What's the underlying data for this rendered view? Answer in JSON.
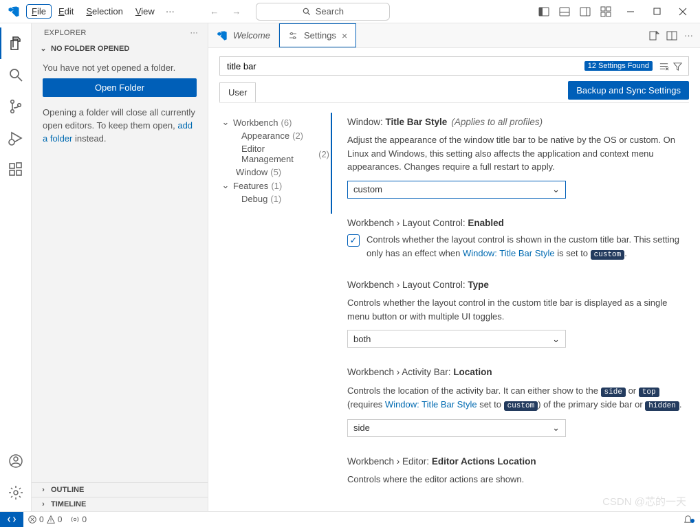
{
  "menu": {
    "file": "File",
    "edit": "Edit",
    "selection": "Selection",
    "view": "View"
  },
  "search_placeholder": "Search",
  "sidebar": {
    "title": "EXPLORER",
    "section": "NO FOLDER OPENED",
    "no_folder": "You have not yet opened a folder.",
    "open_btn": "Open Folder",
    "desc_pre": "Opening a folder will close all currently open editors. To keep them open, ",
    "desc_link": "add a folder",
    "desc_post": " instead.",
    "outline": "OUTLINE",
    "timeline": "TIMELINE"
  },
  "tabs": {
    "welcome": "Welcome",
    "settings": "Settings"
  },
  "search_value": "title bar",
  "found_badge": "12 Settings Found",
  "scope_user": "User",
  "backup_btn": "Backup and Sync Settings",
  "toc": {
    "workbench": "Workbench",
    "workbench_c": "(6)",
    "appearance": "Appearance",
    "appearance_c": "(2)",
    "editor_mgmt": "Editor Management",
    "editor_mgmt_c": "(2)",
    "window": "Window",
    "window_c": "(5)",
    "features": "Features",
    "features_c": "(1)",
    "debug": "Debug",
    "debug_c": "(1)"
  },
  "s1": {
    "scope": "Window: ",
    "name": "Title Bar Style",
    "hint": "(Applies to all profiles)",
    "desc": "Adjust the appearance of the window title bar to be native by the OS or custom. On Linux and Windows, this setting also affects the application and context menu appearances. Changes require a full restart to apply.",
    "value": "custom"
  },
  "s2": {
    "scope": "Workbench › Layout Control: ",
    "name": "Enabled",
    "desc_a": "Controls whether the layout control is shown in the custom title bar. This setting only has an effect when ",
    "link": "Window: Title Bar Style",
    "desc_b": " is set to ",
    "pill": "custom",
    "desc_c": "."
  },
  "s3": {
    "scope": "Workbench › Layout Control: ",
    "name": "Type",
    "desc": "Controls whether the layout control in the custom title bar is displayed as a single menu button or with multiple UI toggles.",
    "value": "both"
  },
  "s4": {
    "scope": "Workbench › Activity Bar: ",
    "name": "Location",
    "desc_a": "Controls the location of the activity bar. It can either show to the ",
    "p1": "side",
    "desc_b": " or ",
    "p2": "top",
    "desc_c": " (requires ",
    "link": "Window: Title Bar Style",
    "desc_d": " set to ",
    "p3": "custom",
    "desc_e": ") of the primary side bar or ",
    "p4": "hidden",
    "desc_f": ".",
    "value": "side"
  },
  "s5": {
    "scope": "Workbench › Editor: ",
    "name": "Editor Actions Location",
    "desc": "Controls where the editor actions are shown."
  },
  "status": {
    "err": "0",
    "warn": "0",
    "port": "0"
  },
  "watermark": "CSDN @芯的一天"
}
